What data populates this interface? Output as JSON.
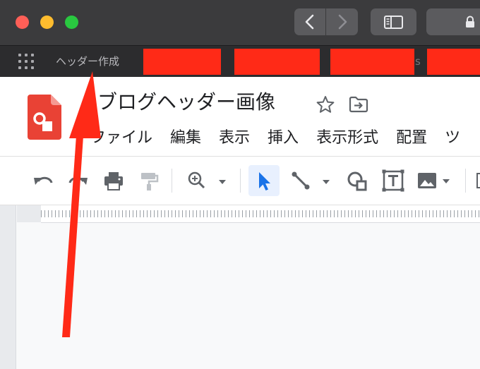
{
  "window": {
    "traffic_lights": [
      "close",
      "minimize",
      "zoom"
    ],
    "colors": {
      "close": "#fe5f57",
      "minimize": "#febc2e",
      "zoom": "#29c840"
    }
  },
  "bookmarks_bar": {
    "apps_icon": "apps-grid-icon",
    "first_bookmark": "ヘッダー作成",
    "separator_fragment": "s"
  },
  "document": {
    "title": "ブログヘッダー画像",
    "logo_icon": "google-slides-icon",
    "star_icon": "star-icon",
    "move_icon": "folder-move-icon",
    "menu": [
      "ファイル",
      "編集",
      "表示",
      "挿入",
      "表示形式",
      "配置",
      "ツ"
    ]
  },
  "toolbar": {
    "buttons": [
      "undo-icon",
      "redo-icon",
      "print-icon",
      "paint-format-icon",
      "zoom-icon",
      "select-cursor-icon",
      "line-icon",
      "shape-icon",
      "text-box-icon",
      "image-icon"
    ],
    "active": "select-cursor-icon",
    "accent": "#1a73e8"
  },
  "annotation": {
    "color": "#ff2a17",
    "shape": "arrow"
  },
  "redaction_color": "#ff2a17"
}
